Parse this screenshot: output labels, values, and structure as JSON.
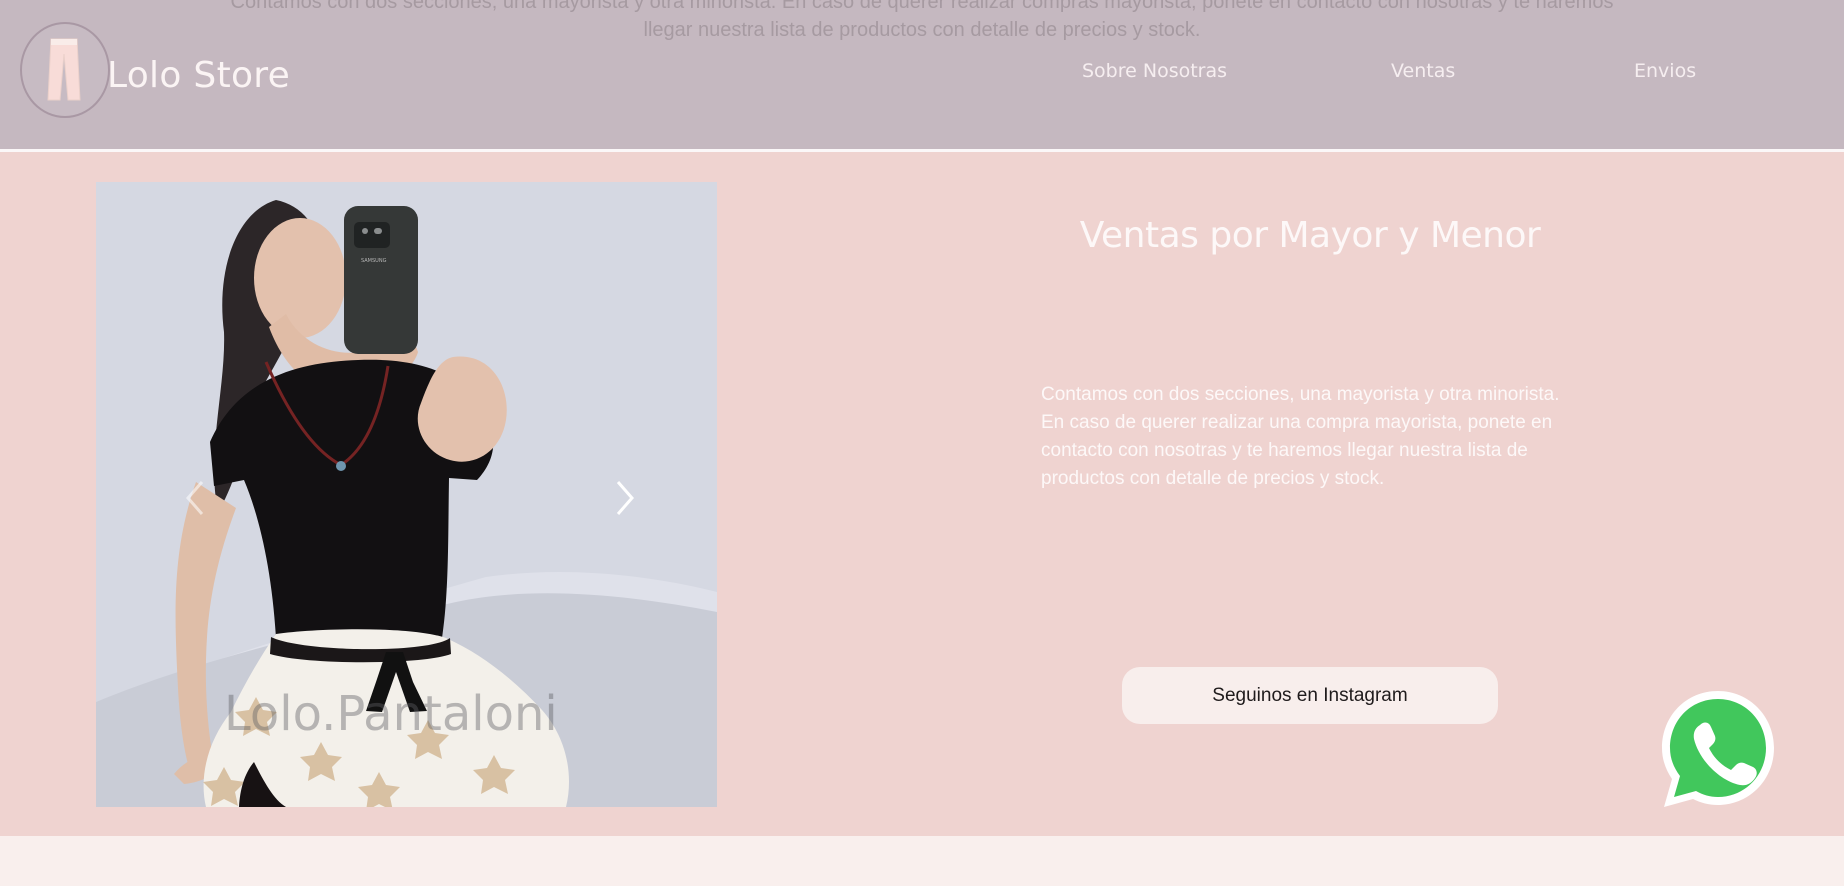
{
  "header": {
    "behind_text": {
      "line_1": "Contamos con dos secciones, una mayorista y otra minorista. En caso de querer realizar compras mayorista, ponete en contacto con nosotras y te haremos",
      "line_2": "llegar nuestra lista de productos con detalle de precios y stock."
    },
    "logo": {
      "title": "Lolo Store",
      "icon": "pants-icon"
    },
    "nav": {
      "about": "Sobre Nosotras",
      "sales": "Ventas",
      "shipping": "Envios"
    }
  },
  "main": {
    "carousel": {
      "watermark": "Lolo.Pantaloni",
      "phone_text": "SAMSUNG",
      "prev_icon": "chevron-left-icon",
      "next_icon": "chevron-right-icon"
    },
    "title": "Ventas por Mayor y Menor",
    "copy": "Contamos con dos secciones, una mayorista y otra minorista. En caso de querer realizar una compra mayorista, ponete en contacto con nosotras y te haremos llegar nuestra lista de productos con detalle de precios y stock.",
    "cta": "Seguinos en Instagram"
  },
  "floating": {
    "whatsapp_icon": "whatsapp-icon"
  },
  "colors": {
    "header": "#c5b8c0",
    "main": "#efd3d0",
    "button": "#f8eeec",
    "whatsapp": "#41c75c"
  }
}
